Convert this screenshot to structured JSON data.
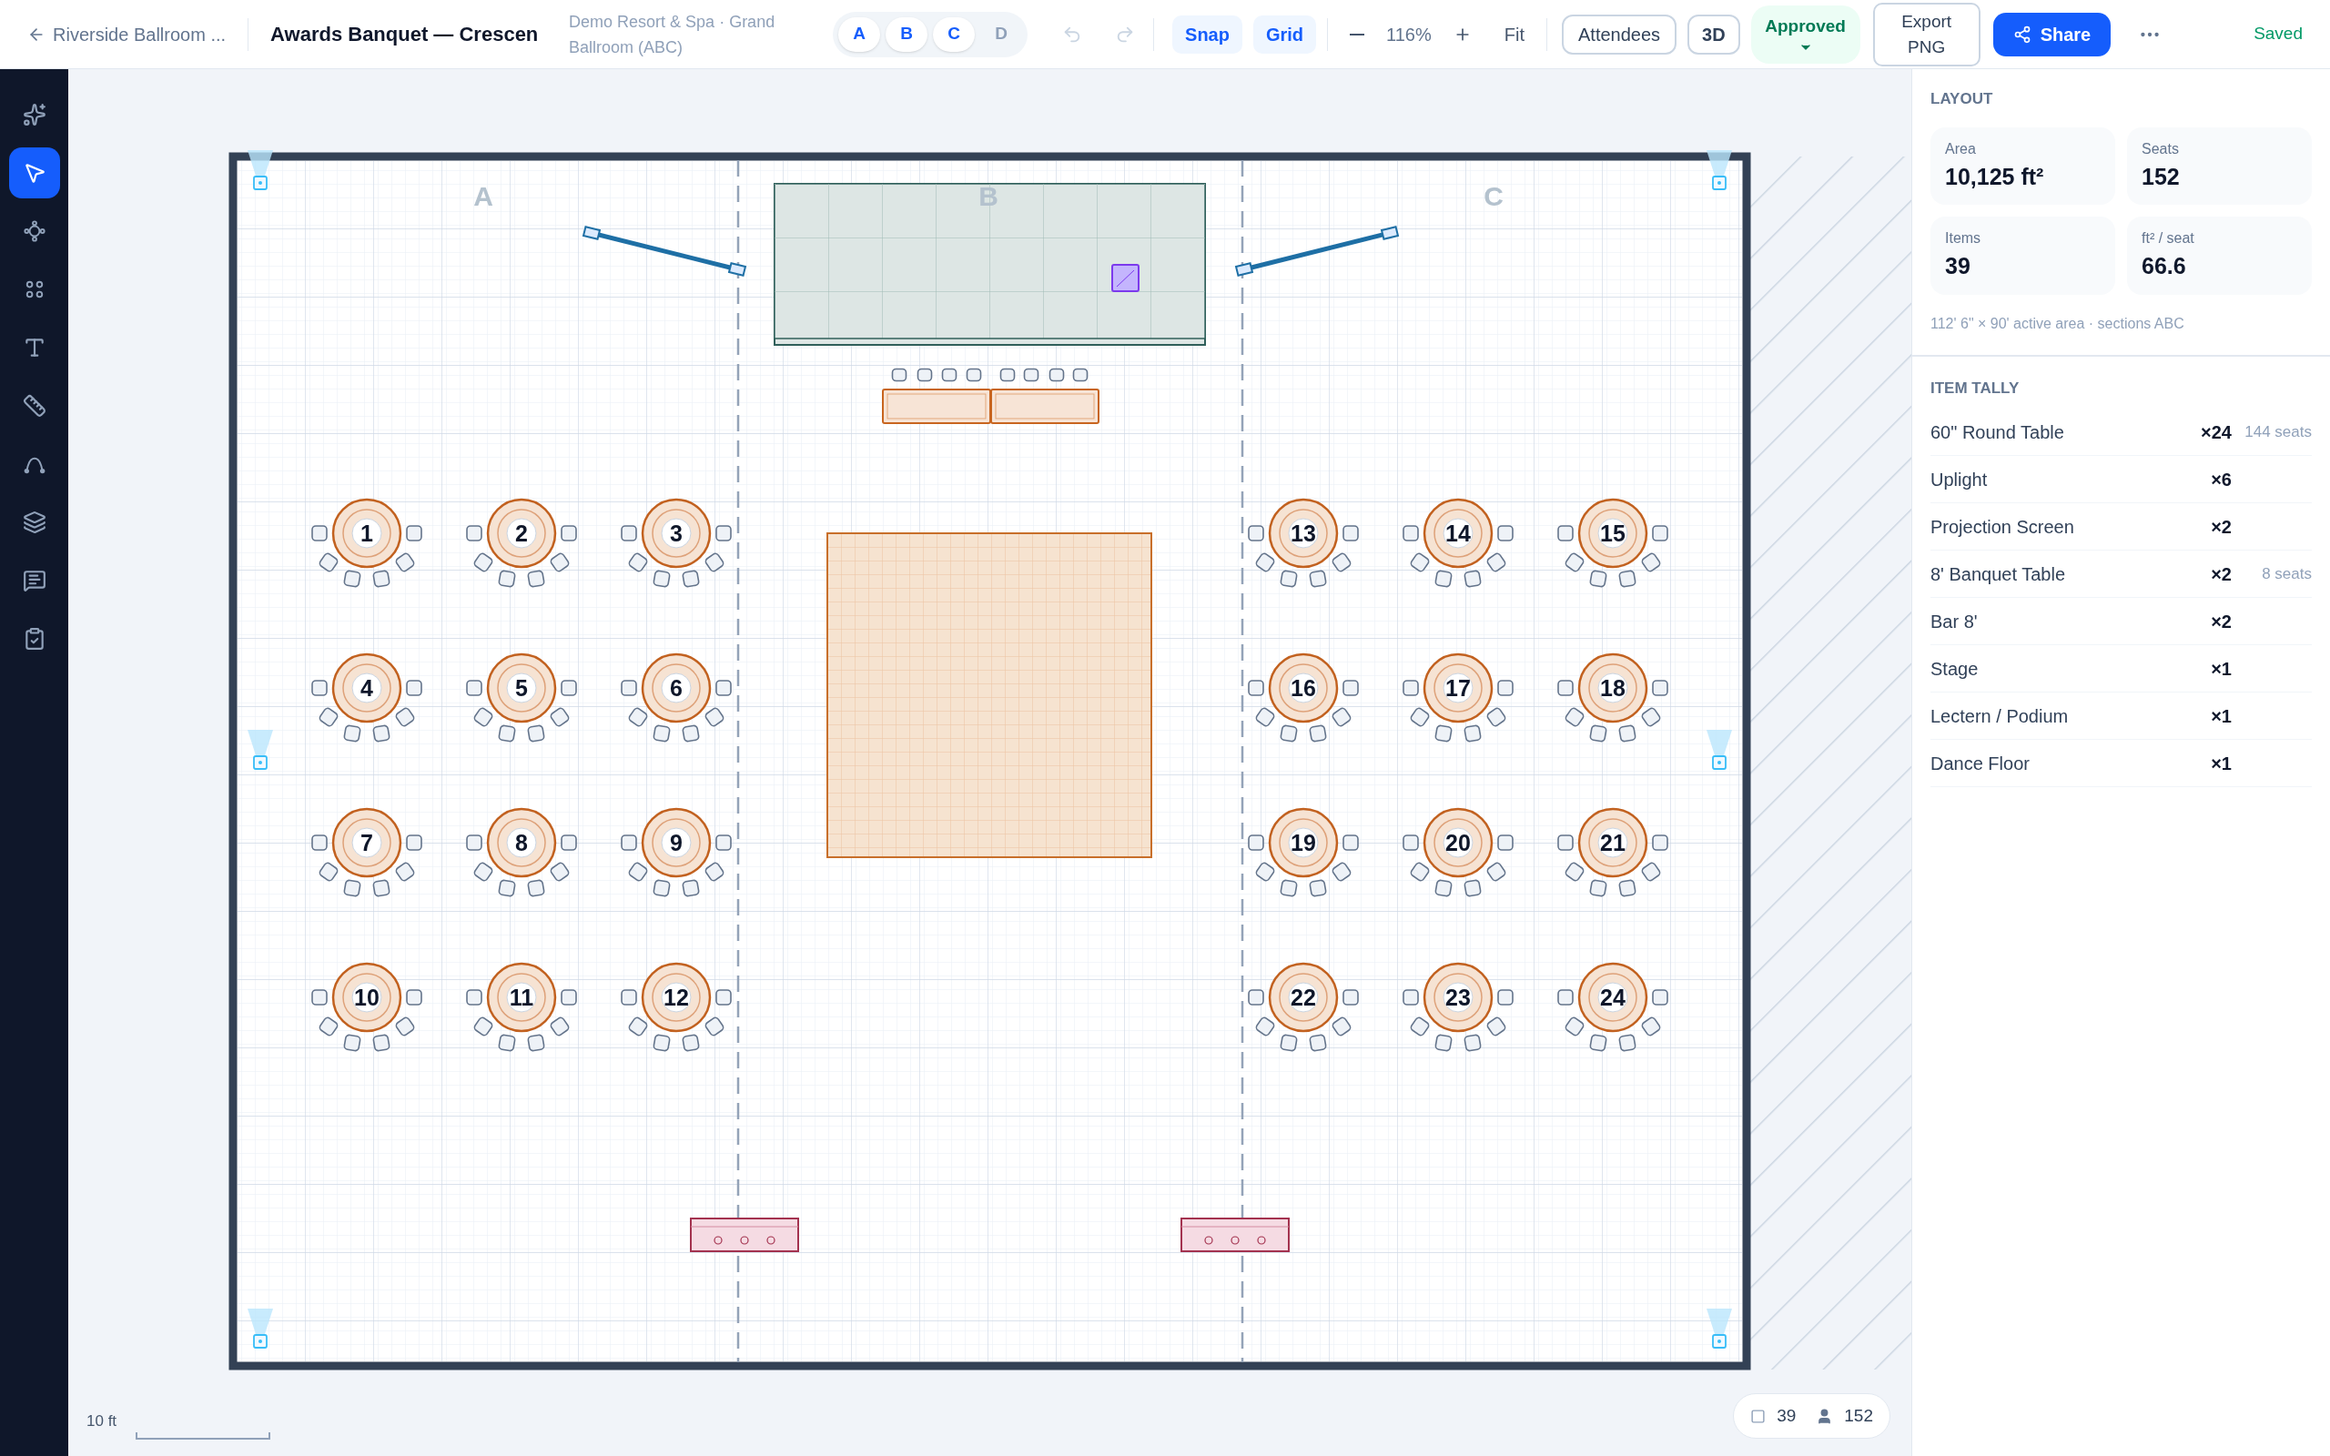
{
  "topbar": {
    "back_link": "Riverside Ballroom ...",
    "title": "Awards Banquet — Crescen",
    "venue": "Demo Resort & Spa · Grand Ballroom (ABC)",
    "sections": [
      {
        "label": "A",
        "selected": true
      },
      {
        "label": "B",
        "selected": true
      },
      {
        "label": "C",
        "selected": true
      },
      {
        "label": "D",
        "selected": false
      }
    ],
    "toggles": [
      {
        "label": "Snap",
        "on": true
      },
      {
        "label": "Grid",
        "on": true
      }
    ],
    "zoom": "116%",
    "fit": "Fit",
    "attendees": "Attendees",
    "view_3d": "3D",
    "status": "Approved",
    "export": "Export PNG",
    "share": "Share",
    "save_status": "Saved"
  },
  "tools": [
    {
      "kind": "ai",
      "selected": false
    },
    {
      "kind": "select",
      "selected": true
    },
    {
      "kind": "nodes",
      "selected": false
    },
    {
      "kind": "objects",
      "selected": false
    },
    {
      "kind": "text",
      "selected": false
    },
    {
      "kind": "measure",
      "selected": false
    },
    {
      "kind": "curve",
      "selected": false
    },
    {
      "kind": "layers",
      "selected": false
    },
    {
      "kind": "comments",
      "selected": false
    },
    {
      "kind": "checklist",
      "selected": false
    }
  ],
  "canvas": {
    "section_labels": [
      "A",
      "B",
      "C"
    ],
    "tables": [
      "1",
      "2",
      "3",
      "13",
      "14",
      "15",
      "4",
      "5",
      "6",
      "16",
      "17",
      "18",
      "7",
      "8",
      "9",
      "19",
      "20",
      "21",
      "10",
      "11",
      "12",
      "22",
      "23",
      "24"
    ],
    "scale": "10 ft",
    "item_count": "39",
    "seat_count": "152"
  },
  "panel": {
    "layout_title": "LAYOUT",
    "stats": [
      {
        "label": "Area",
        "value": "10,125 ft²"
      },
      {
        "label": "Seats",
        "value": "152"
      },
      {
        "label": "Items",
        "value": "39"
      },
      {
        "label": "ft² / seat",
        "value": "66.6"
      }
    ],
    "note": "112' 6\" × 90' active area · sections ABC",
    "tally_title": "ITEM TALLY",
    "tally": [
      {
        "name": "60\" Round Table",
        "count": "×24",
        "note": "144 seats"
      },
      {
        "name": "Uplight",
        "count": "×6"
      },
      {
        "name": "Projection Screen",
        "count": "×2"
      },
      {
        "name": "8' Banquet Table",
        "count": "×2",
        "note": "8 seats"
      },
      {
        "name": "Bar 8'",
        "count": "×2"
      },
      {
        "name": "Stage",
        "count": "×1"
      },
      {
        "name": "Lectern / Podium",
        "count": "×1"
      },
      {
        "name": "Dance Floor",
        "count": "×1"
      }
    ]
  }
}
